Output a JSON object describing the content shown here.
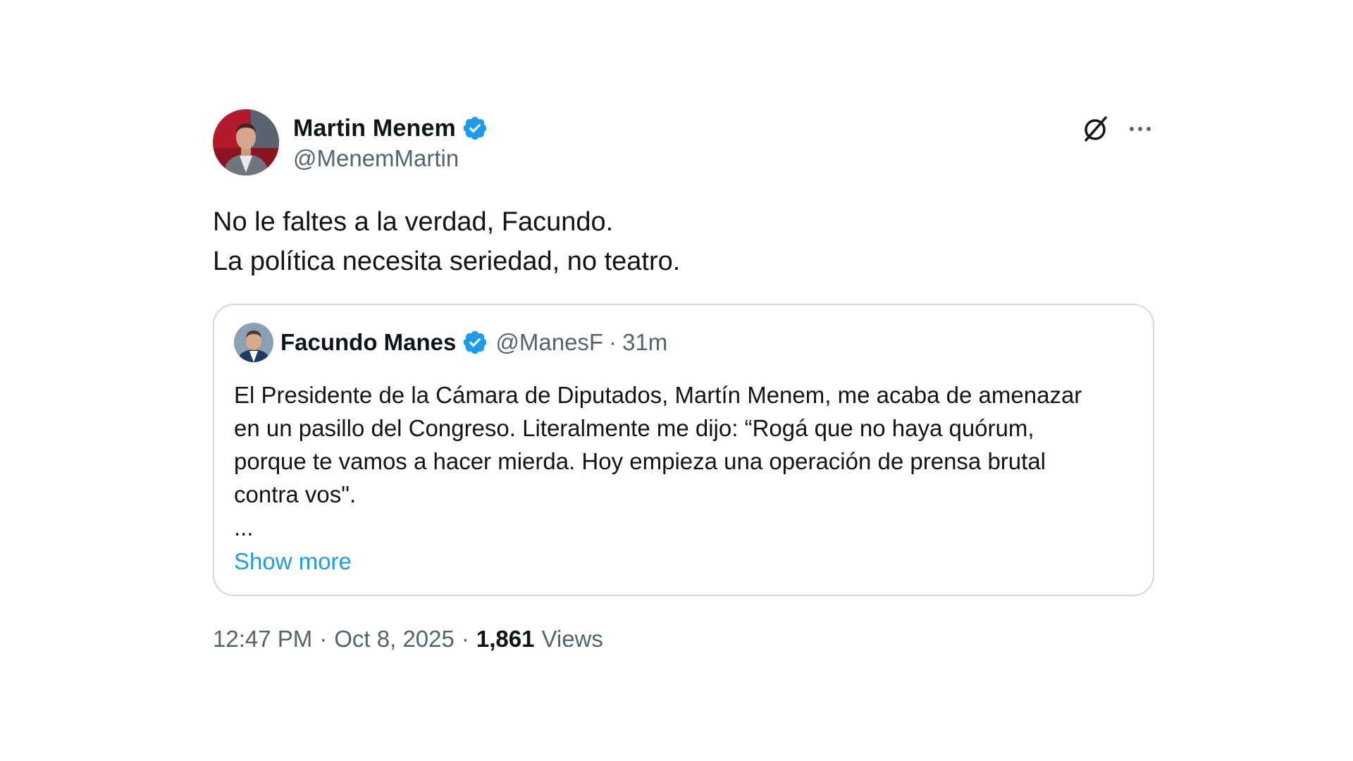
{
  "author": {
    "display_name": "Martin Menem",
    "handle": "@MenemMartin",
    "verified_icon": "verified-badge-icon"
  },
  "actions": {
    "grok_icon": "grok-icon",
    "more_icon": "more-options-icon"
  },
  "tweet": {
    "lines": [
      "No le faltes a la verdad, Facundo.",
      "La política necesita seriedad, no teatro."
    ]
  },
  "quote": {
    "display_name": "Facundo Manes",
    "handle": "@ManesF",
    "dot": "·",
    "time": "31m",
    "text": "El Presidente de la Cámara de Diputados, Martín Menem, me acaba de amenazar\nen un pasillo del Congreso. Literalmente me dijo: “Rogá que no haya quórum,\nporque te vamos a hacer mierda. Hoy empieza una operación de prensa brutal\ncontra vos\".\n...",
    "show_more": "Show more"
  },
  "meta": {
    "time": "12:47 PM",
    "sep1": "·",
    "date": "Oct 8, 2025",
    "sep2": "·",
    "views_count": "1,861",
    "views_label": "Views"
  },
  "colors": {
    "text": "#0f1419",
    "secondary": "#536471",
    "link": "#1d9bf0",
    "verified": "#1d9bf0",
    "border": "#cfd9de"
  }
}
